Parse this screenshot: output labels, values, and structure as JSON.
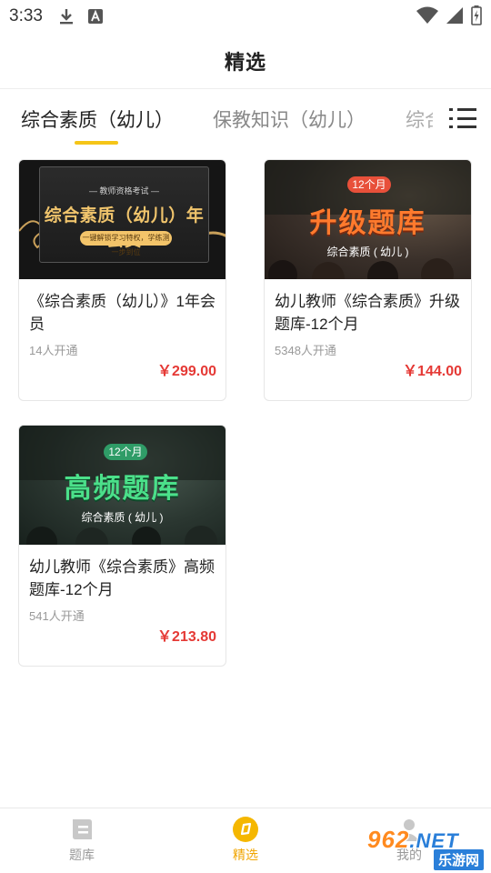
{
  "status_bar": {
    "time": "3:33",
    "icons": [
      "download-icon",
      "font-a-icon",
      "wifi-icon",
      "signal-icon",
      "battery-icon"
    ]
  },
  "header": {
    "title": "精选"
  },
  "tabs": [
    {
      "label": "综合素质（幼儿）",
      "active": true
    },
    {
      "label": "保教知识（幼儿）",
      "active": false
    },
    {
      "label": "综合",
      "active": false
    }
  ],
  "colors": {
    "accent": "#f5c518",
    "price": "#e53935",
    "nav_active": "#f0a500"
  },
  "cards": [
    {
      "title": "《综合素质（幼儿）》1年会员",
      "subscribers": "14人开通",
      "price": "￥299.00",
      "thumb": {
        "top": "— 教师资格考试 —",
        "main": "综合素质（幼儿）年会员",
        "pill": "一键解锁学习特权，学练测一步到位"
      }
    },
    {
      "title": "幼儿教师《综合素质》升级题库-12个月",
      "subscribers": "5348人开通",
      "price": "￥144.00",
      "thumb": {
        "month": "12个月",
        "big": "升级题库",
        "sub": "综合素质 ( 幼儿 )"
      }
    },
    {
      "title": "幼儿教师《综合素质》高频题库-12个月",
      "subscribers": "541人开通",
      "price": "￥213.80",
      "thumb": {
        "month": "12个月",
        "big": "高频题库",
        "sub": "综合素质 ( 幼儿 )"
      }
    }
  ],
  "bottom_nav": [
    {
      "label": "题库",
      "icon": "question-bank-icon",
      "active": false
    },
    {
      "label": "精选",
      "icon": "featured-icon",
      "active": true
    },
    {
      "label": "我的",
      "icon": "profile-icon",
      "active": false
    }
  ],
  "watermark": {
    "logo": "962",
    "logo_suffix": ".NET",
    "sub": "乐游网"
  }
}
